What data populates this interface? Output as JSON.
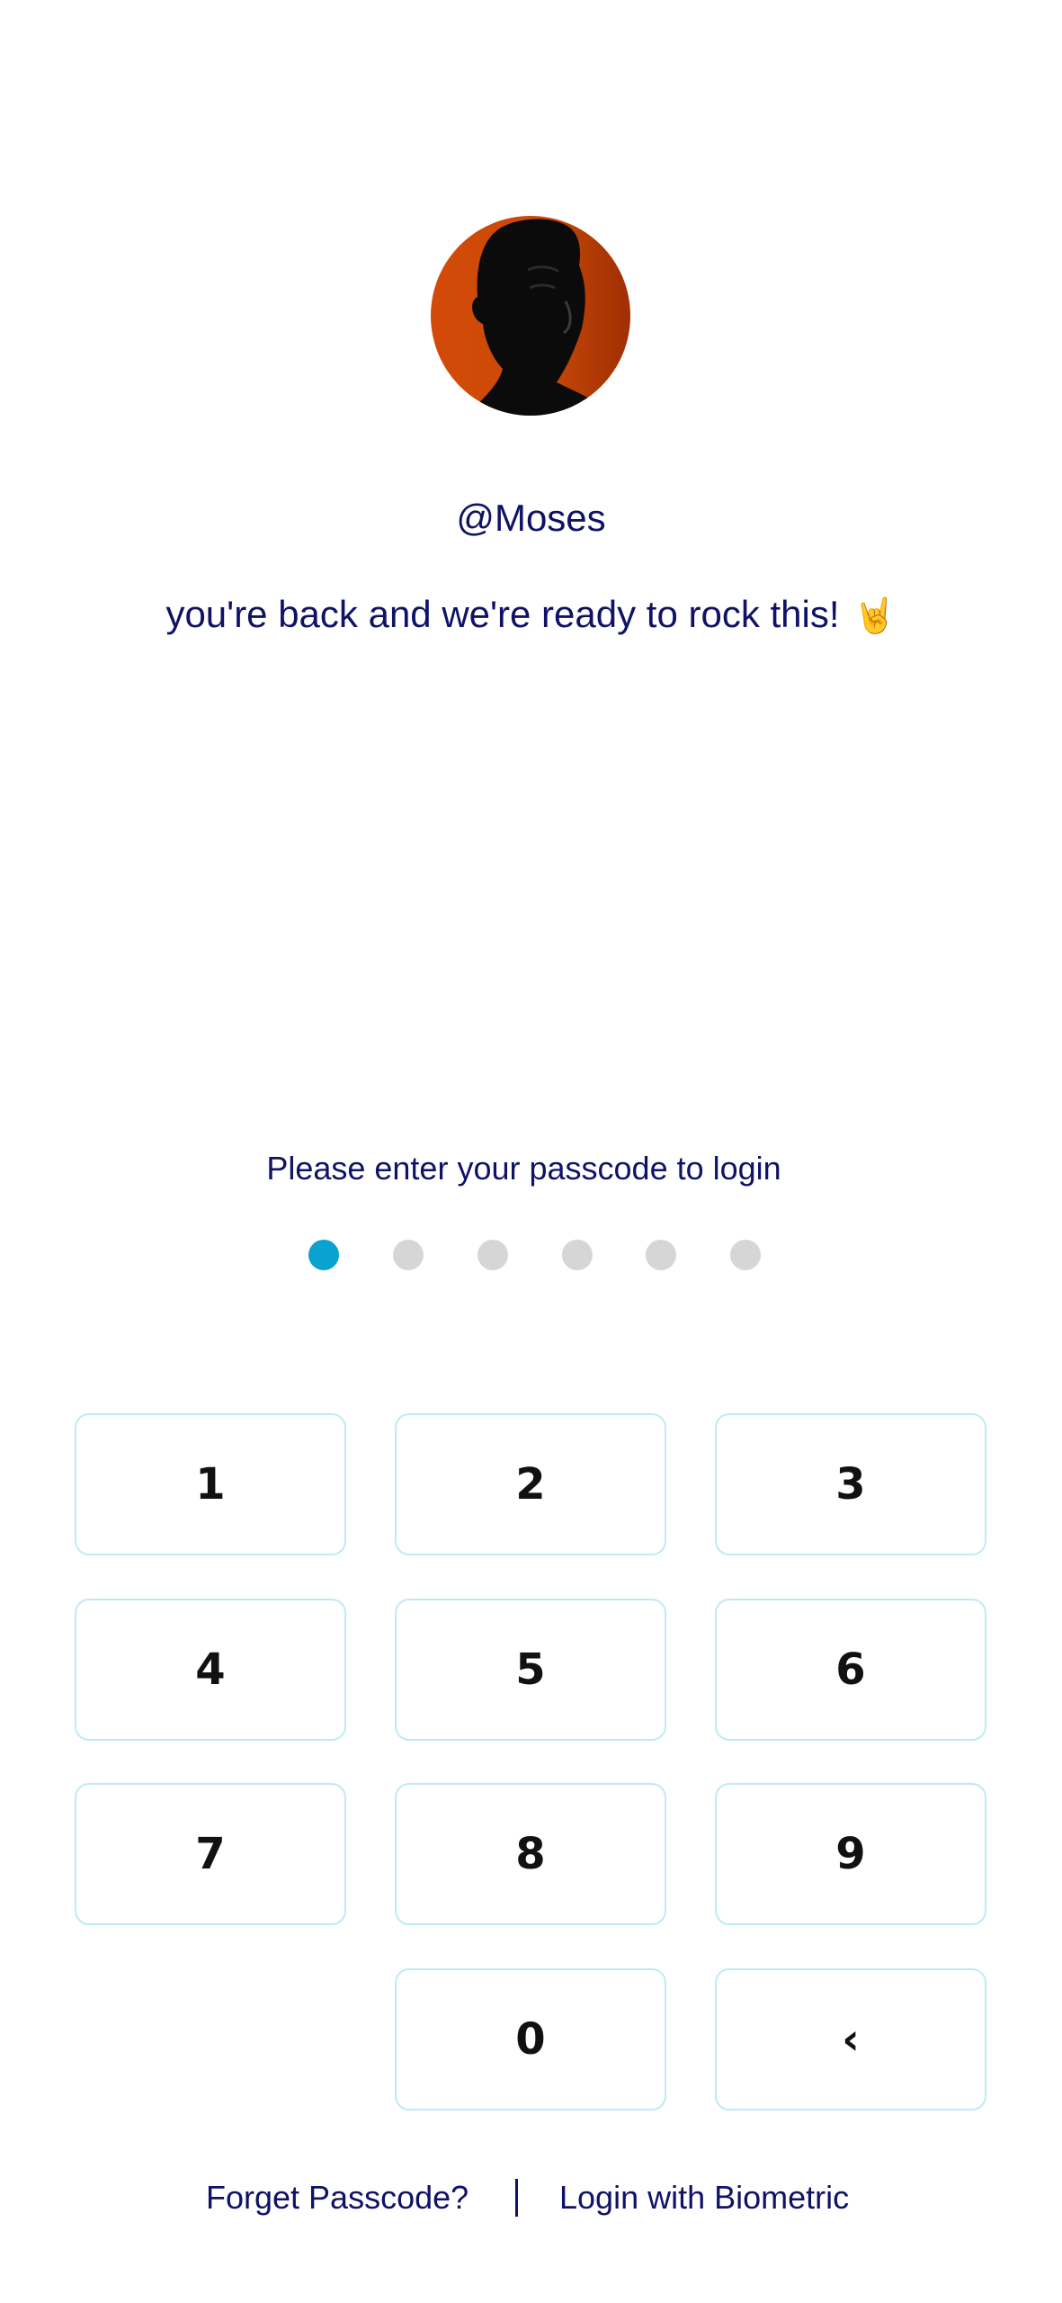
{
  "profile": {
    "username": "@Moses",
    "greeting": "you're back and we're ready to rock this!",
    "greeting_emoji": "🤘"
  },
  "passcode": {
    "prompt": "Please enter your passcode to login",
    "length": 6,
    "entered": 1,
    "filled_color": "#0aa3d1",
    "empty_color": "#d6d6d6"
  },
  "keypad": {
    "keys": [
      "1",
      "2",
      "3",
      "4",
      "5",
      "6",
      "7",
      "8",
      "9",
      "0"
    ],
    "backspace": "‹"
  },
  "footer": {
    "forgot_label": "Forget Passcode?",
    "biometric_label": "Login with Biometric"
  },
  "colors": {
    "text_navy": "#0f1365",
    "key_border": "#bfeaf5",
    "avatar_bg": "#d44a08"
  }
}
